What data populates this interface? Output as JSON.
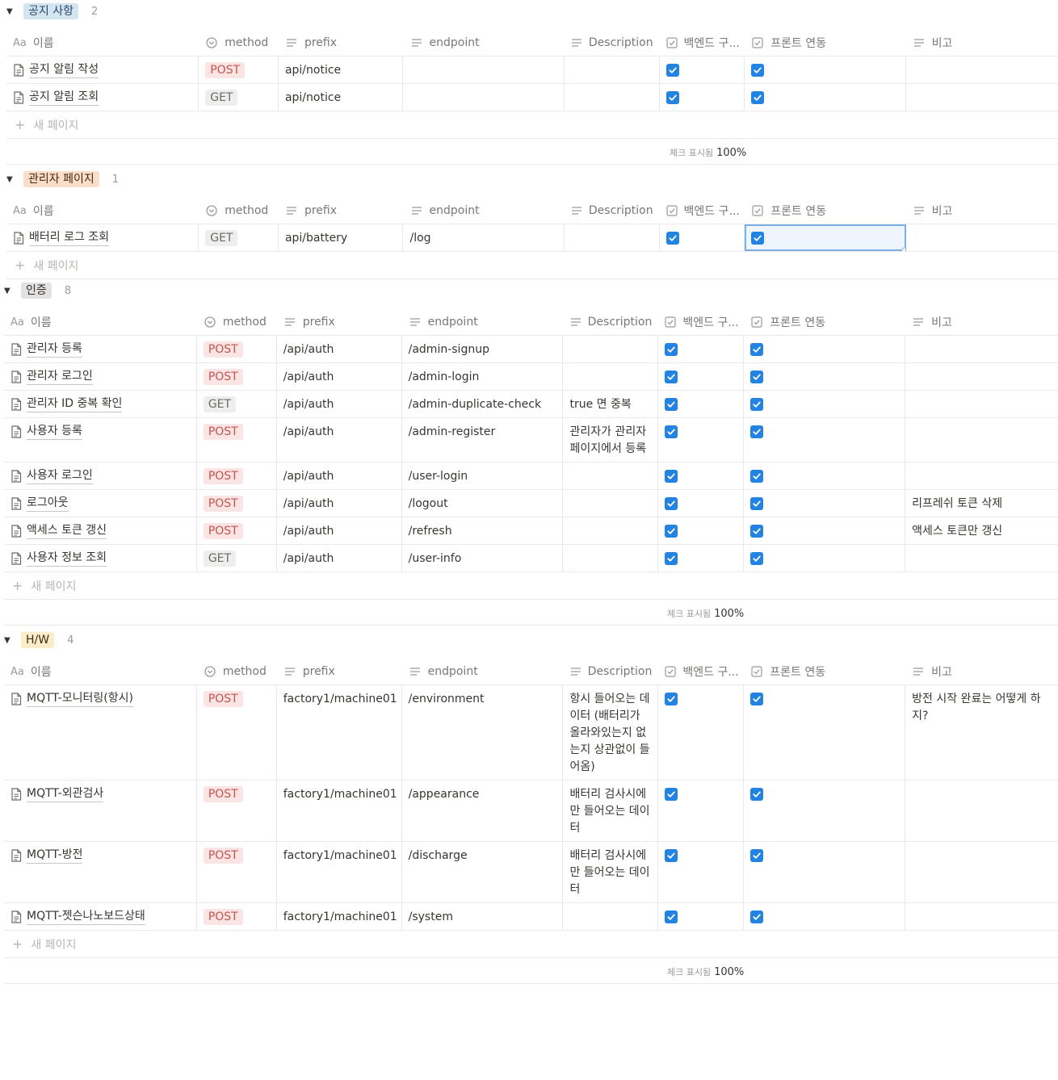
{
  "columns": {
    "name": "이름",
    "name_icon": "Aa",
    "method": "method",
    "prefix": "prefix",
    "endpoint": "endpoint",
    "description": "Description",
    "backend": "백엔드 구...",
    "front": "프론트 연동",
    "note": "비고"
  },
  "new_page_label": "새 페이지",
  "summary": {
    "label": "체크 표시됨",
    "value": "100%"
  },
  "colors": {
    "accent": "#2383e2",
    "post_bg": "#fbe4e4",
    "post_fg": "#c4554d",
    "get_bg": "#eeeeed"
  },
  "groups": [
    {
      "tag": "공지 사항",
      "tag_bg": "#d3e5ef",
      "tag_fg": "#28456c",
      "count": "2",
      "rows": [
        {
          "name": "공지 알림 작성",
          "method": "POST",
          "prefix": "api/notice",
          "endpoint": "",
          "description": "",
          "backend": true,
          "front": true,
          "note": ""
        },
        {
          "name": "공지 알림 조회",
          "method": "GET",
          "prefix": "api/notice",
          "endpoint": "",
          "description": "",
          "backend": true,
          "front": true,
          "note": ""
        }
      ]
    },
    {
      "tag": "관리자 페이지",
      "tag_bg": "#fadec9",
      "tag_fg": "#49290e",
      "count": "1",
      "rows": [
        {
          "name": "배터리 로그 조회",
          "method": "GET",
          "prefix": "api/battery",
          "endpoint": "/log",
          "description": "",
          "backend": true,
          "front": true,
          "note": ""
        }
      ]
    },
    {
      "tag": "인증",
      "tag_bg": "#e3e2e0",
      "tag_fg": "#32302c",
      "count": "8",
      "rows": [
        {
          "name": "관리자 등록",
          "method": "POST",
          "prefix": "/api/auth",
          "endpoint": "/admin-signup",
          "description": "",
          "backend": true,
          "front": true,
          "note": ""
        },
        {
          "name": "관리자 로그인",
          "method": "POST",
          "prefix": "/api/auth",
          "endpoint": "/admin-login",
          "description": "",
          "backend": true,
          "front": true,
          "note": ""
        },
        {
          "name": "관리자 ID 중복 확인",
          "method": "GET",
          "prefix": "/api/auth",
          "endpoint": "/admin-duplicate-check",
          "description": "true 면 중복",
          "backend": true,
          "front": true,
          "note": ""
        },
        {
          "name": "사용자 등록",
          "method": "POST",
          "prefix": "/api/auth",
          "endpoint": "/admin-register",
          "description": "관리자가 관리자 페이지에서 등록",
          "backend": true,
          "front": true,
          "note": ""
        },
        {
          "name": "사용자 로그인",
          "method": "POST",
          "prefix": "/api/auth",
          "endpoint": "/user-login",
          "description": "",
          "backend": true,
          "front": true,
          "note": ""
        },
        {
          "name": "로그아웃",
          "method": "POST",
          "prefix": "/api/auth",
          "endpoint": "/logout",
          "description": "",
          "backend": true,
          "front": true,
          "note": "리프레쉬 토큰 삭제"
        },
        {
          "name": "액세스 토큰 갱신",
          "method": "POST",
          "prefix": "/api/auth",
          "endpoint": "/refresh",
          "description": "",
          "backend": true,
          "front": true,
          "note": "액세스 토큰만 갱신"
        },
        {
          "name": "사용자 정보 조회",
          "method": "GET",
          "prefix": "/api/auth",
          "endpoint": "/user-info",
          "description": "",
          "backend": true,
          "front": true,
          "note": ""
        }
      ]
    },
    {
      "tag": "H/W",
      "tag_bg": "#fdecc8",
      "tag_fg": "#402c1b",
      "count": "4",
      "rows": [
        {
          "name": "MQTT-모니터링(항시)",
          "method": "POST",
          "prefix": "factory1/machine01",
          "endpoint": "/environment",
          "description": "항시 들어오는 데이터 (배터리가 올라와있는지 없는지 상관없이 들어옴)",
          "backend": true,
          "front": true,
          "note": "방전 시작 완료는 어떻게 하지?"
        },
        {
          "name": "MQTT-외관검사",
          "method": "POST",
          "prefix": "factory1/machine01",
          "endpoint": "/appearance",
          "description": "배터리 검사시에만 들어오는 데이터",
          "backend": true,
          "front": true,
          "note": ""
        },
        {
          "name": "MQTT-방전",
          "method": "POST",
          "prefix": "factory1/machine01",
          "endpoint": "/discharge",
          "description": "배터리 검사시에만 들어오는 데이터",
          "backend": true,
          "front": true,
          "note": ""
        },
        {
          "name": "MQTT-젯슨나노보드상태",
          "method": "POST",
          "prefix": "factory1/machine01",
          "endpoint": "/system",
          "description": "",
          "backend": true,
          "front": true,
          "note": ""
        }
      ]
    }
  ]
}
